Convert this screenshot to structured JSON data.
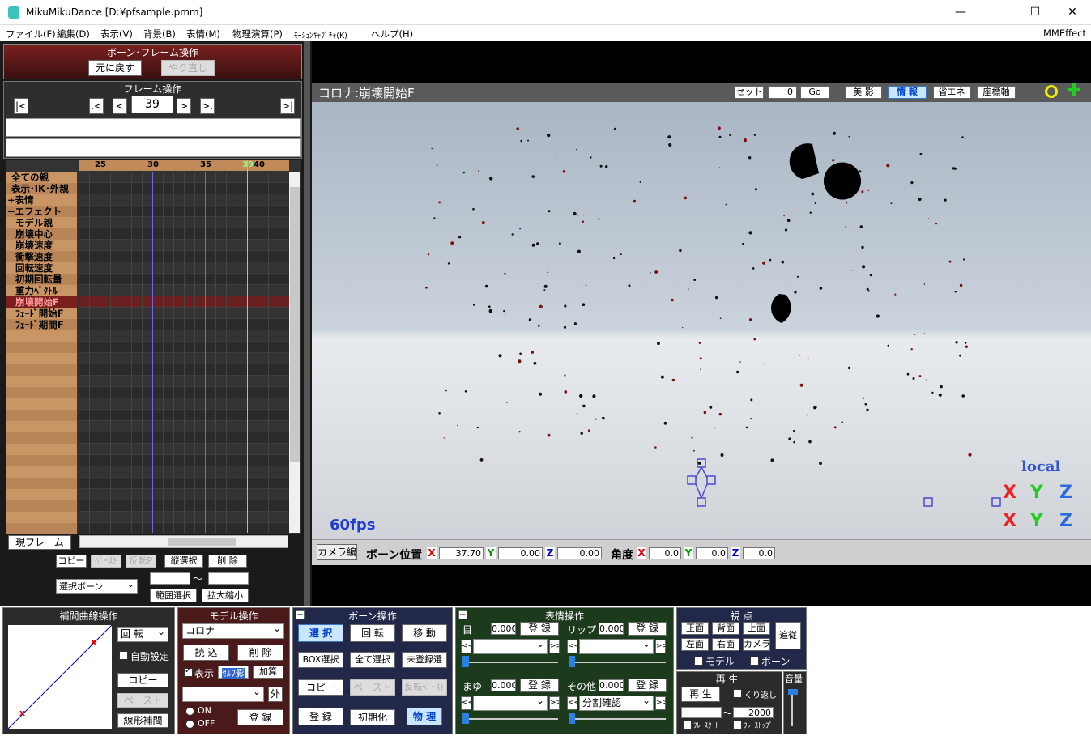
{
  "window": {
    "title": "MikuMikuDance [D:¥pfsample.pmm]",
    "minimize": "—",
    "maximize": "☐",
    "close": "✕"
  },
  "menu": {
    "items": [
      "ファイル(F)",
      "編集(D)",
      "表示(V)",
      "背景(B)",
      "表情(M)",
      "物理演算(P)",
      "ﾓｰｼｮﾝｷｬﾌﾟﾁｬ(K)",
      "ヘルプ(H)"
    ],
    "right": "MMEffect"
  },
  "bone_frame": {
    "title": "ボーン･フレーム操作",
    "undo": "元に戻す",
    "redo": "やり直し"
  },
  "frame_op": {
    "title": "フレーム操作",
    "first": "|<",
    "prev_key": ".<",
    "prev": "<",
    "frame": "39",
    "next": ">",
    "next_key": ">.",
    "last": ">|"
  },
  "timeline": {
    "ticks": [
      "25",
      "30",
      "35",
      "39",
      "40"
    ],
    "rows": [
      {
        "label": "全ての親",
        "indent": 1,
        "color": "#000"
      },
      {
        "label": "表示･IK･外親",
        "indent": 1,
        "color": "#000"
      },
      {
        "label": "+表情",
        "indent": 0,
        "color": "#000"
      },
      {
        "label": "−エフェクト",
        "indent": 0,
        "color": "#000"
      },
      {
        "label": "モデル親",
        "indent": 2,
        "color": "#000"
      },
      {
        "label": "崩壊中心",
        "indent": 2,
        "color": "#000"
      },
      {
        "label": "崩壊速度",
        "indent": 2,
        "color": "#000"
      },
      {
        "label": "衝撃速度",
        "indent": 2,
        "color": "#000"
      },
      {
        "label": "回転速度",
        "indent": 2,
        "color": "#000"
      },
      {
        "label": "初期回転量",
        "indent": 2,
        "color": "#000"
      },
      {
        "label": "重力ﾍﾞｸﾄﾙ",
        "indent": 2,
        "color": "#000"
      },
      {
        "label": "崩壊開始F",
        "indent": 2,
        "color": "#ff9999",
        "selected": true
      },
      {
        "label": "ﾌｪｰﾄﾞ開始F",
        "indent": 2,
        "color": "#000"
      },
      {
        "label": "ﾌｪｰﾄﾞ期間F",
        "indent": 2,
        "color": "#000"
      }
    ],
    "empty_rows": 18,
    "current_frame_btn": "現フレーム"
  },
  "frame_tools": {
    "copy": "コピー",
    "paste": "ﾍﾟｰｽﾄ",
    "paste_rev": "反転P",
    "vsel": "縦選択",
    "delete": "削 除",
    "bone_select": "選択ボーン",
    "tilde": "〜",
    "range_sel": "範囲選択",
    "scale": "拡大縮小"
  },
  "viewport": {
    "title": "コロナ:崩壊開始F",
    "set": "セット",
    "set_value": "0",
    "go": "Go",
    "beauty": "美 影",
    "info": "情 報",
    "eco": "省エネ",
    "axis": "座標軸",
    "fps": "60fps",
    "local": "local",
    "axes": [
      "X",
      "Y",
      "Z"
    ]
  },
  "bone_pos": {
    "camera": "カメラ編",
    "pos_label": "ボーン位置",
    "x": "37.70",
    "y": "0.00",
    "z": "0.00",
    "angle_label": "角度",
    "ax": "0.0",
    "ay": "0.0",
    "az": "0.0",
    "axis_x": "X",
    "axis_y": "Y",
    "axis_z": "Z"
  },
  "interp": {
    "title": "補間曲線操作",
    "mode": "回 転",
    "auto": "自動設定",
    "copy": "コピー",
    "paste": "ペースト",
    "linear": "線形補間"
  },
  "model_op": {
    "title": "モデル操作",
    "model": "コロナ",
    "load": "読 込",
    "delete": "削 除",
    "display": "表示",
    "self_shadow": "ｾﾙﾌ影",
    "add": "加算",
    "ext": "外",
    "on": "ON",
    "off": "OFF",
    "register": "登 録"
  },
  "bone_op": {
    "title": "ボーン操作",
    "minus": "−",
    "select": "選 択",
    "rotate": "回 転",
    "move": "移 動",
    "box": "BOX選択",
    "all": "全て選択",
    "unreg": "未登録選",
    "copy": "コピー",
    "paste": "ペースト",
    "paste_rev": "反転ﾍﾟｰｽﾄ",
    "register": "登 録",
    "init": "初期化",
    "physics": "物 理"
  },
  "face_op": {
    "title": "表情操作",
    "minus": "−",
    "eye": "目",
    "eye_v": "0.000",
    "lip": "リップ",
    "lip_v": "0.000",
    "brow": "まゆ",
    "brow_v": "0.000",
    "other": "その他",
    "other_v": "0.000",
    "register": "登 録",
    "other_sel": "分割確認",
    "l": "<<",
    "r": ">>"
  },
  "view": {
    "title": "視 点",
    "front": "正面",
    "back": "背面",
    "top": "上面",
    "left": "左面",
    "right": "右面",
    "camera": "カメラ",
    "follow": "追従",
    "model": "モデル",
    "bone": "ボーン"
  },
  "play": {
    "title": "再 生",
    "play": "再 生",
    "repeat": "くり返し",
    "tilde": "〜",
    "end": "2000",
    "fstart": "ﾌﾚｰｽﾀｰﾄ",
    "fstop": "ﾌﾚｰｽﾄｯﾌﾟ",
    "volume": "音量"
  }
}
